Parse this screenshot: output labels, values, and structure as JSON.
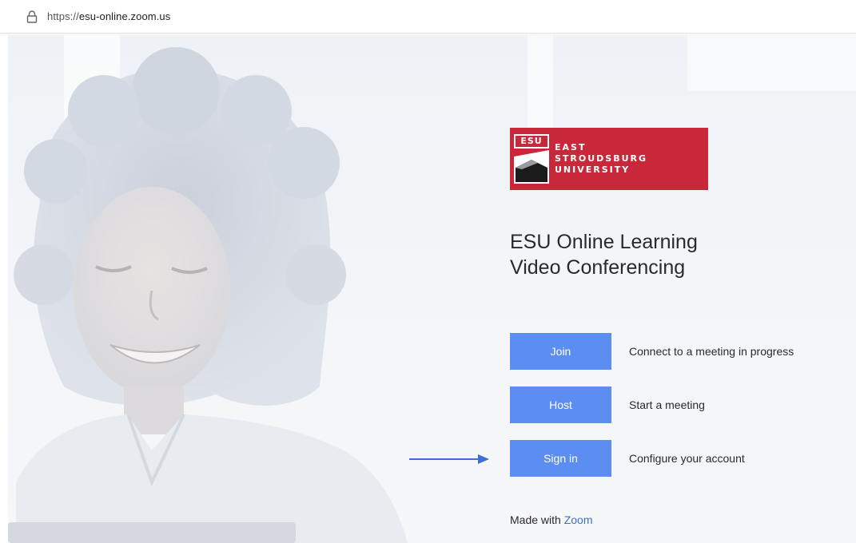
{
  "browser": {
    "url_scheme": "https://",
    "url_domain": "esu-online.zoom.us"
  },
  "logo": {
    "abbr": "ESU",
    "line1": "EAST",
    "line2": "STROUDSBURG",
    "line3": "UNIVERSITY",
    "brand_color": "#c8283a"
  },
  "title": {
    "line1": "ESU Online Learning",
    "line2": "Video Conferencing"
  },
  "actions": [
    {
      "label": "Join",
      "description": "Connect to a meeting in progress"
    },
    {
      "label": "Host",
      "description": "Start a meeting"
    },
    {
      "label": "Sign in",
      "description": "Configure your account"
    }
  ],
  "footer": {
    "made_with": "Made with",
    "zoom_link": "Zoom"
  },
  "colors": {
    "button": "#5b8ef0",
    "arrow": "#3f6ed8",
    "link": "#3f6ed8"
  }
}
